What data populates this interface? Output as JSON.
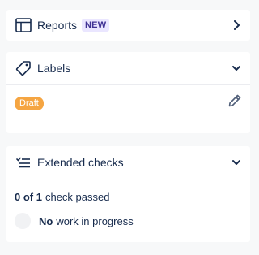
{
  "reports": {
    "label": "Reports",
    "badge": "NEW"
  },
  "labels": {
    "title": "Labels",
    "tag": "Draft",
    "tag_color": "#f5a542"
  },
  "checks": {
    "title": "Extended checks",
    "passed_count": "0 of 1",
    "passed_suffix": "check passed",
    "wip_strong": "No",
    "wip_rest": "work in progress"
  },
  "icons": {
    "reports": "report-icon",
    "labels": "tag-icon",
    "checks": "checklist-icon",
    "edit": "pencil-icon",
    "chevron_right": "chevron-right-icon",
    "chevron_down": "chevron-down-icon"
  }
}
